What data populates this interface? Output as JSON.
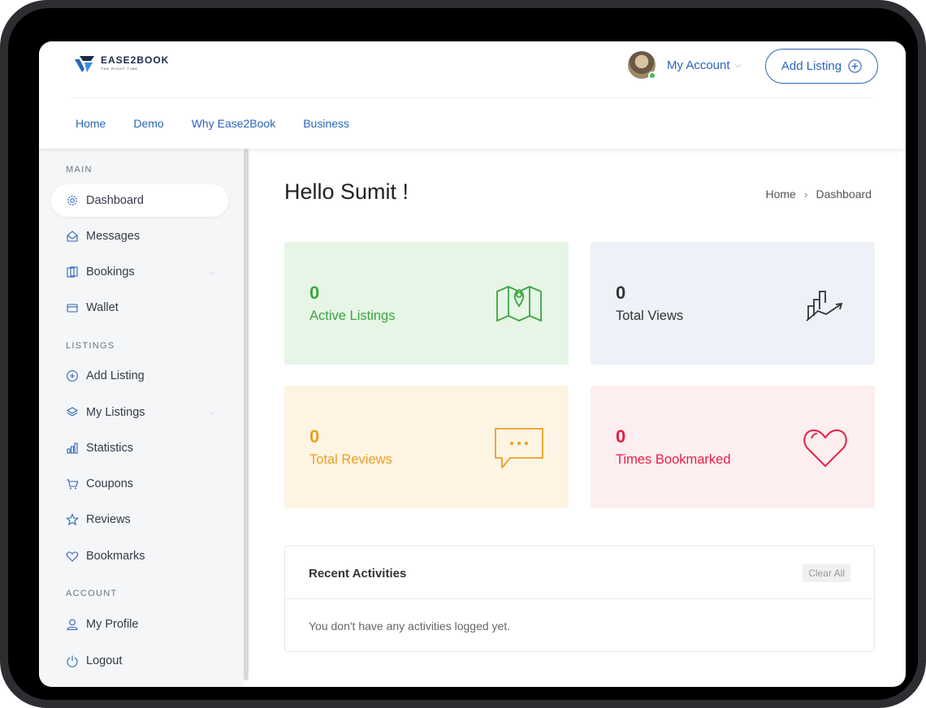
{
  "brand": {
    "name": "EASE2BOOK",
    "tagline": "THE RIGHT TIME"
  },
  "header": {
    "account_label": "My Account",
    "add_listing_label": "Add Listing",
    "nav": [
      {
        "label": "Home"
      },
      {
        "label": "Demo"
      },
      {
        "label": "Why Ease2Book"
      },
      {
        "label": "Business"
      }
    ]
  },
  "sidebar": {
    "sections": {
      "main": "MAIN",
      "listings": "LISTINGS",
      "account": "ACCOUNT"
    },
    "items": [
      {
        "label": "Dashboard",
        "icon": "gear-icon",
        "active": true
      },
      {
        "label": "Messages",
        "icon": "envelope-icon"
      },
      {
        "label": "Bookings",
        "icon": "bookings-icon",
        "expandable": true
      },
      {
        "label": "Wallet",
        "icon": "wallet-icon"
      },
      {
        "label": "Add Listing",
        "icon": "plus-circle-icon"
      },
      {
        "label": "My Listings",
        "icon": "layers-icon",
        "expandable": true
      },
      {
        "label": "Statistics",
        "icon": "bar-chart-icon"
      },
      {
        "label": "Coupons",
        "icon": "cart-icon"
      },
      {
        "label": "Reviews",
        "icon": "star-icon"
      },
      {
        "label": "Bookmarks",
        "icon": "heart-icon"
      },
      {
        "label": "My Profile",
        "icon": "user-icon"
      },
      {
        "label": "Logout",
        "icon": "power-icon"
      }
    ]
  },
  "main": {
    "greeting": "Hello Sumit !",
    "breadcrumb": [
      "Home",
      "Dashboard"
    ],
    "cards": [
      {
        "value": "0",
        "label": "Active Listings",
        "icon": "map-pin-icon",
        "color": "#3aa640",
        "bg": "#e6f5e6"
      },
      {
        "value": "0",
        "label": "Total Views",
        "icon": "chart-growth-icon",
        "color": "#333333",
        "bg": "#eef1f8"
      },
      {
        "value": "0",
        "label": "Total Reviews",
        "icon": "speech-bubble-icon",
        "color": "#e8a023",
        "bg": "#fdf4e3"
      },
      {
        "value": "0",
        "label": "Times Bookmarked",
        "icon": "heart-icon",
        "color": "#e61f44",
        "bg": "#fdeef0"
      }
    ],
    "activities": {
      "title": "Recent Activities",
      "clear_label": "Clear All",
      "empty_text": "You don't have any activities logged yet."
    }
  }
}
